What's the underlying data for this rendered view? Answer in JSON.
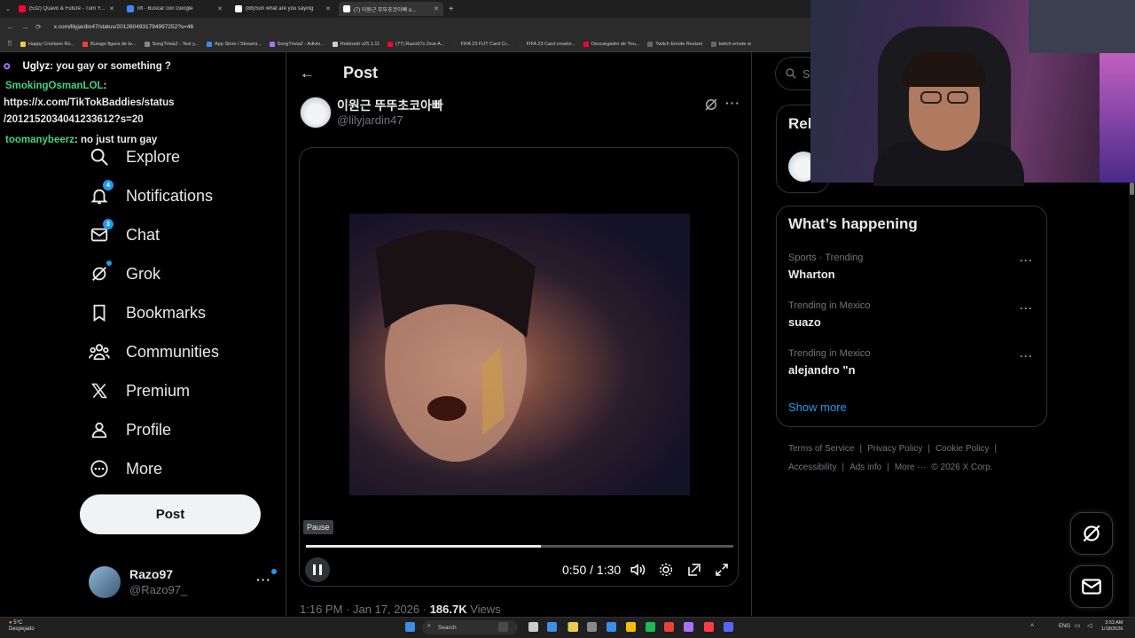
{
  "browser": {
    "tabs": [
      {
        "title": "(532) Quavo & Future - Turn Y...",
        "color": "#ff0033",
        "active": false
      },
      {
        "title": "nfl - Buscar con Google",
        "color": "#4285f4",
        "active": false
      },
      {
        "title": "(88)Son what are you saying",
        "color": "#ffffff",
        "active": false
      },
      {
        "title": "(7) 이원근 뚜뚜초코아빠 o...",
        "color": "#ffffff",
        "active": true
      }
    ],
    "url": "x.com/lilyjardin47/status/2012604931794997252?s=46",
    "bookmarks": [
      "Happy Cristiano Ro...",
      "Burago figura de to...",
      "SongTrivia2 - Test y...",
      "App Store / Streami...",
      "SongTrivia2 - Adivin...",
      "Reletoob v25.1.11",
      "(77) Razo97s Zest-A...",
      "FIFA 23 FUT Card Cr...",
      "FIFA 23 Card creator...",
      "Descargador de You...",
      "Twitch Emote Resizer",
      "twitch emote w"
    ]
  },
  "chat": [
    {
      "user": "Uglyz",
      "user_color": "#ffffff",
      "message": ": you gay or something ?"
    },
    {
      "user": "SmokingOsmanLOL",
      "user_color": "#46d37a",
      "message": ":"
    },
    {
      "user": "",
      "user_color": "#ffffff",
      "message": "https://x.com/TikTokBaddies/status"
    },
    {
      "user": "",
      "user_color": "#ffffff",
      "message": "/2012152034041233612?s=20"
    },
    {
      "user": "toomanybeerz",
      "user_color": "#46d37a",
      "message": ": no just turn gay"
    }
  ],
  "nav": {
    "items": [
      {
        "label": "Explore",
        "icon": "search-icon",
        "badge": ""
      },
      {
        "label": "Notifications",
        "icon": "bell-icon",
        "badge": "4"
      },
      {
        "label": "Chat",
        "icon": "mail-icon",
        "badge": "3"
      },
      {
        "label": "Grok",
        "icon": "grok-icon",
        "badge": ""
      },
      {
        "label": "Bookmarks",
        "icon": "bookmark-icon",
        "badge": ""
      },
      {
        "label": "Communities",
        "icon": "communities-icon",
        "badge": ""
      },
      {
        "label": "Premium",
        "icon": "x-logo-icon",
        "badge": ""
      },
      {
        "label": "Profile",
        "icon": "person-icon",
        "badge": ""
      },
      {
        "label": "More",
        "icon": "more-circle-icon",
        "badge": ""
      }
    ],
    "post_button": "Post",
    "account": {
      "name": "Razo97",
      "handle": "@Razo97_"
    }
  },
  "post": {
    "header_title": "Post",
    "author_name": "이원근 뚜뚜초코아빠",
    "author_handle": "@lilyjardin47",
    "video": {
      "pause_tooltip": "Pause",
      "time": "0:50 / 1:30",
      "progress": 0.55
    },
    "timestamp": "1:16 PM · Jan 17, 2026 · ",
    "views_count": "186.7K",
    "views_label": " Views"
  },
  "sidebar": {
    "search_placeholder": "Se",
    "relevant_title": "Rele",
    "happening_title": "What’s happening",
    "trends": [
      {
        "context": "Sports · Trending",
        "name": "Wharton"
      },
      {
        "context": "Trending in Mexico",
        "name": "suazo"
      },
      {
        "context": "Trending in Mexico",
        "name": "alejandro \"n"
      }
    ],
    "show_more": "Show more",
    "footer": {
      "row1": [
        "Terms of Service",
        "Privacy Policy",
        "Cookie Policy"
      ],
      "row2": [
        "Accessibility",
        "Ads info",
        "More ···",
        "© 2026 X Corp."
      ]
    }
  },
  "taskbar": {
    "weather_temp": "5°C",
    "weather_desc": "Despejado",
    "search_label": "Search",
    "lang": "ENG",
    "time": "3:53 AM",
    "date": "1/18/2026"
  }
}
